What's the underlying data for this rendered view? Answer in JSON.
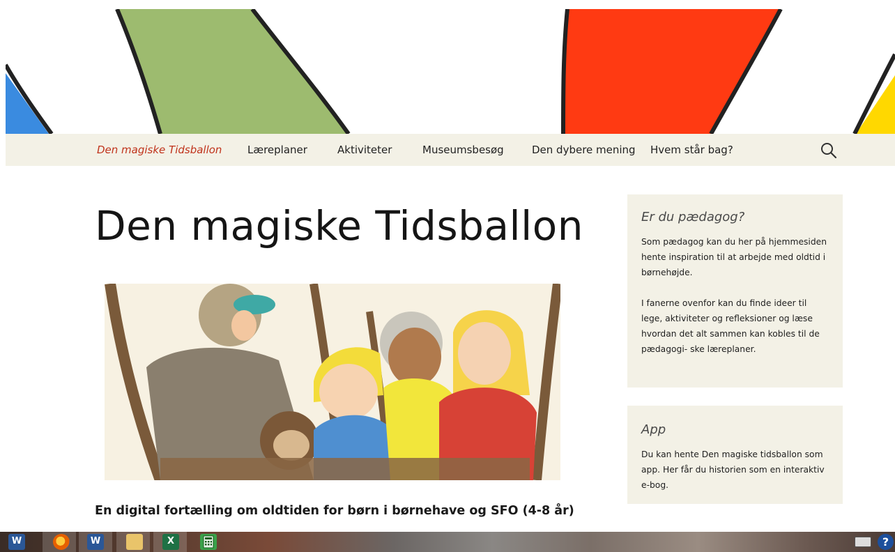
{
  "nav": {
    "items": [
      {
        "label": "Den magiske Tidsballon",
        "active": true
      },
      {
        "label": "Læreplaner",
        "active": false
      },
      {
        "label": "Aktiviteter",
        "active": false
      },
      {
        "label": "Museumsbesøg",
        "active": false
      },
      {
        "label": "Den dybere mening",
        "active": false
      },
      {
        "label": "Hvem står bag?",
        "active": false
      }
    ],
    "search_icon": "search-icon"
  },
  "main": {
    "title": "Den magiske Tidsballon",
    "subtitle": "En digital fortælling om oldtiden for børn i børnehave og SFO (4-8 år)"
  },
  "sidebar": {
    "paedagog": {
      "heading": "Er du pædagog?",
      "paragraphs": [
        "Som pædagog kan du her på hjemmesiden hente inspiration til at arbejde med oldtid i børnehøjde.",
        "I fanerne ovenfor kan du finde ideer til lege, aktiviteter og refleksioner og læse hvordan det alt sammen kan kobles til de pædagogi- ske læreplaner."
      ]
    },
    "app": {
      "heading": "App",
      "paragraph": "Du kan hente Den magiske tidsballon som app. Her får du historien som en interaktiv e-bog."
    }
  },
  "taskbar": {
    "apps": [
      {
        "name": "word-icon",
        "letter": "W"
      },
      {
        "name": "firefox-icon",
        "letter": ""
      },
      {
        "name": "word-icon",
        "letter": "W"
      },
      {
        "name": "file-explorer-icon",
        "letter": ""
      },
      {
        "name": "excel-icon",
        "letter": "X"
      },
      {
        "name": "calculator-icon",
        "letter": ""
      }
    ],
    "tray": {
      "keyboard_icon": "keyboard-icon",
      "help_label": "?"
    }
  },
  "colors": {
    "accent": "#c0331b",
    "nav_bg": "#f3f1e6",
    "stripe_blue": "#3a8be0",
    "stripe_green": "#9dbb6f",
    "stripe_red": "#ff3a12",
    "stripe_yellow": "#ffd800"
  }
}
